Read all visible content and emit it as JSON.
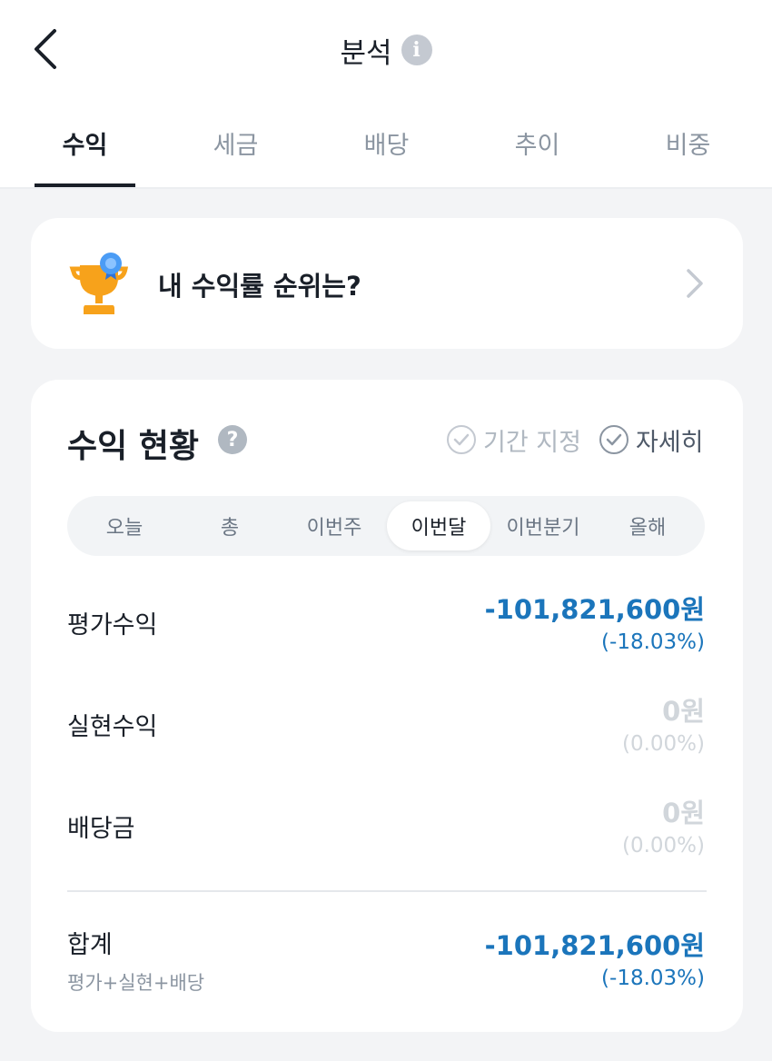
{
  "header": {
    "title": "분석",
    "info_icon": "info-icon"
  },
  "tabs": [
    {
      "label": "수익",
      "active": true
    },
    {
      "label": "세금",
      "active": false
    },
    {
      "label": "배당",
      "active": false
    },
    {
      "label": "추이",
      "active": false
    },
    {
      "label": "비중",
      "active": false
    }
  ],
  "rank_card": {
    "label": "내 수익률 순위는?",
    "icon": "trophy-icon"
  },
  "profit_status": {
    "title": "수익 현황",
    "period_option": "기간 지정",
    "detail_option": "자세히",
    "periods": [
      {
        "label": "오늘",
        "active": false
      },
      {
        "label": "총",
        "active": false
      },
      {
        "label": "이번주",
        "active": false
      },
      {
        "label": "이번달",
        "active": true
      },
      {
        "label": "이번분기",
        "active": false
      },
      {
        "label": "올해",
        "active": false
      }
    ],
    "rows": [
      {
        "label": "평가수익",
        "amount": "-101,821,600원",
        "percent": "(-18.03%)"
      },
      {
        "label": "실현수익",
        "amount": "0원",
        "percent": "(0.00%)"
      },
      {
        "label": "배당금",
        "amount": "0원",
        "percent": "(0.00%)"
      }
    ],
    "total": {
      "label": "합계",
      "sub_label": "평가+실현+배당",
      "amount": "-101,821,600원",
      "percent": "(-18.03%)"
    }
  },
  "colors": {
    "accent_blue": "#1b75bb",
    "muted_grey": "#d1d6db",
    "trophy_orange": "#f7a21b",
    "ribbon_blue": "#4b9cf5"
  }
}
